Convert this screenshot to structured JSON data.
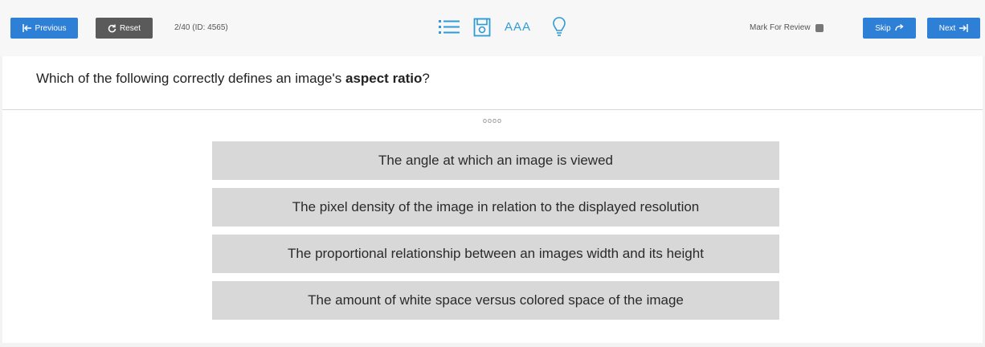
{
  "toolbar": {
    "previous_label": "Previous",
    "reset_label": "Reset",
    "counter": "2/40 (ID: 4565)",
    "mark_label": "Mark For Review",
    "skip_label": "Skip",
    "next_label": "Next",
    "icons": [
      "list-icon",
      "save-icon",
      "font-size-icon",
      "lightbulb-icon"
    ],
    "font_size_text": "AAA"
  },
  "question": {
    "prefix": "Which of the following correctly defines an image's ",
    "bold": "aspect ratio",
    "suffix": "?"
  },
  "drag_handle": "oooo",
  "options": [
    "The angle at which an image is viewed",
    "The pixel density of the image in relation to the displayed resolution",
    "The proportional relationship between an images width and its height",
    "The amount of white space versus colored space of the image"
  ],
  "colors": {
    "accent": "#2e7fd6",
    "reset": "#5a5a5a",
    "option_bg": "#d8d8d8"
  }
}
